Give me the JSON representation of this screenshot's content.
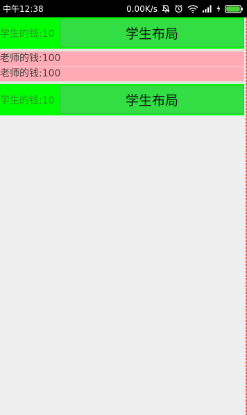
{
  "status_bar": {
    "time": "中午12:38",
    "net_speed": "0.00K/s"
  },
  "rows": {
    "student_1": {
      "money_text": "学生的钱:10",
      "button_label": "学生布局"
    },
    "teacher_1": {
      "money_text": "老师的钱:100"
    },
    "teacher_2": {
      "money_text": "老师的钱:100"
    },
    "student_2": {
      "money_text": "学生的钱:10",
      "button_label": "学生布局"
    }
  },
  "colors": {
    "student_bg": "#00ff00",
    "student_button": "#33dd44",
    "teacher_bg": "#ffaab4",
    "page_bg": "#eeeeee"
  }
}
